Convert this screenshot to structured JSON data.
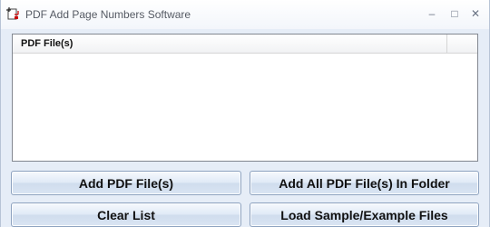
{
  "window": {
    "title": "PDF Add Page Numbers Software",
    "controls": {
      "minimize": "–",
      "maximize": "□",
      "close": "✕"
    }
  },
  "file_list": {
    "columns": [
      "PDF File(s)"
    ],
    "rows": []
  },
  "buttons": {
    "add_files": "Add PDF File(s)",
    "add_folder": "Add All PDF File(s) In Folder",
    "clear_list": "Clear List",
    "load_samples": "Load Sample/Example Files"
  }
}
